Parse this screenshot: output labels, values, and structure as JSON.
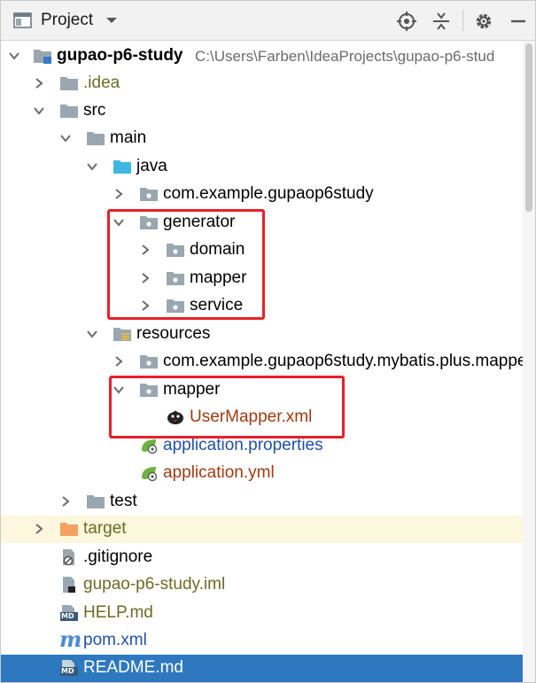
{
  "toolbar": {
    "view_title": "Project",
    "icons": [
      "project-window-icon",
      "dropdown-chevron-icon",
      "locate-target-icon",
      "collapse-all-icon",
      "settings-gear-icon",
      "hide-minimize-icon"
    ]
  },
  "tree": {
    "root": {
      "label": "gupao-p6-study",
      "path": "C:\\Users\\Farben\\IdeaProjects\\gupao-p6-stud"
    },
    "idea": ".idea",
    "src": "src",
    "main": "main",
    "java": "java",
    "pkg_example": "com.example.gupaop6study",
    "generator": "generator",
    "domain": "domain",
    "gen_mapper": "mapper",
    "service": "service",
    "resources": "resources",
    "res_pkg": "com.example.gupaop6study.mybatis.plus.mappe",
    "res_mapper": "mapper",
    "usermapper_xml": "UserMapper.xml",
    "app_properties": "application.properties",
    "app_yml": "application.yml",
    "test": "test",
    "target": "target",
    "gitignore": ".gitignore",
    "iml": "gupao-p6-study.iml",
    "help_md": "HELP.md",
    "md_badge": "MD",
    "m_badge": "m",
    "pom": "pom.xml",
    "readme": "README.md"
  },
  "colors": {
    "toolbar_bg": "#f2f2f2",
    "folder_gray": "#9aa7b0",
    "folder_blue": "#40b6e0",
    "folder_orange": "#f4a261",
    "highlight_red": "#e8202a",
    "selection_blue": "#2e78c0",
    "selection_yellow": "#fdf8dd",
    "link_blue": "#2050a8",
    "olive": "#6b6b25",
    "rust": "#a03a10"
  }
}
